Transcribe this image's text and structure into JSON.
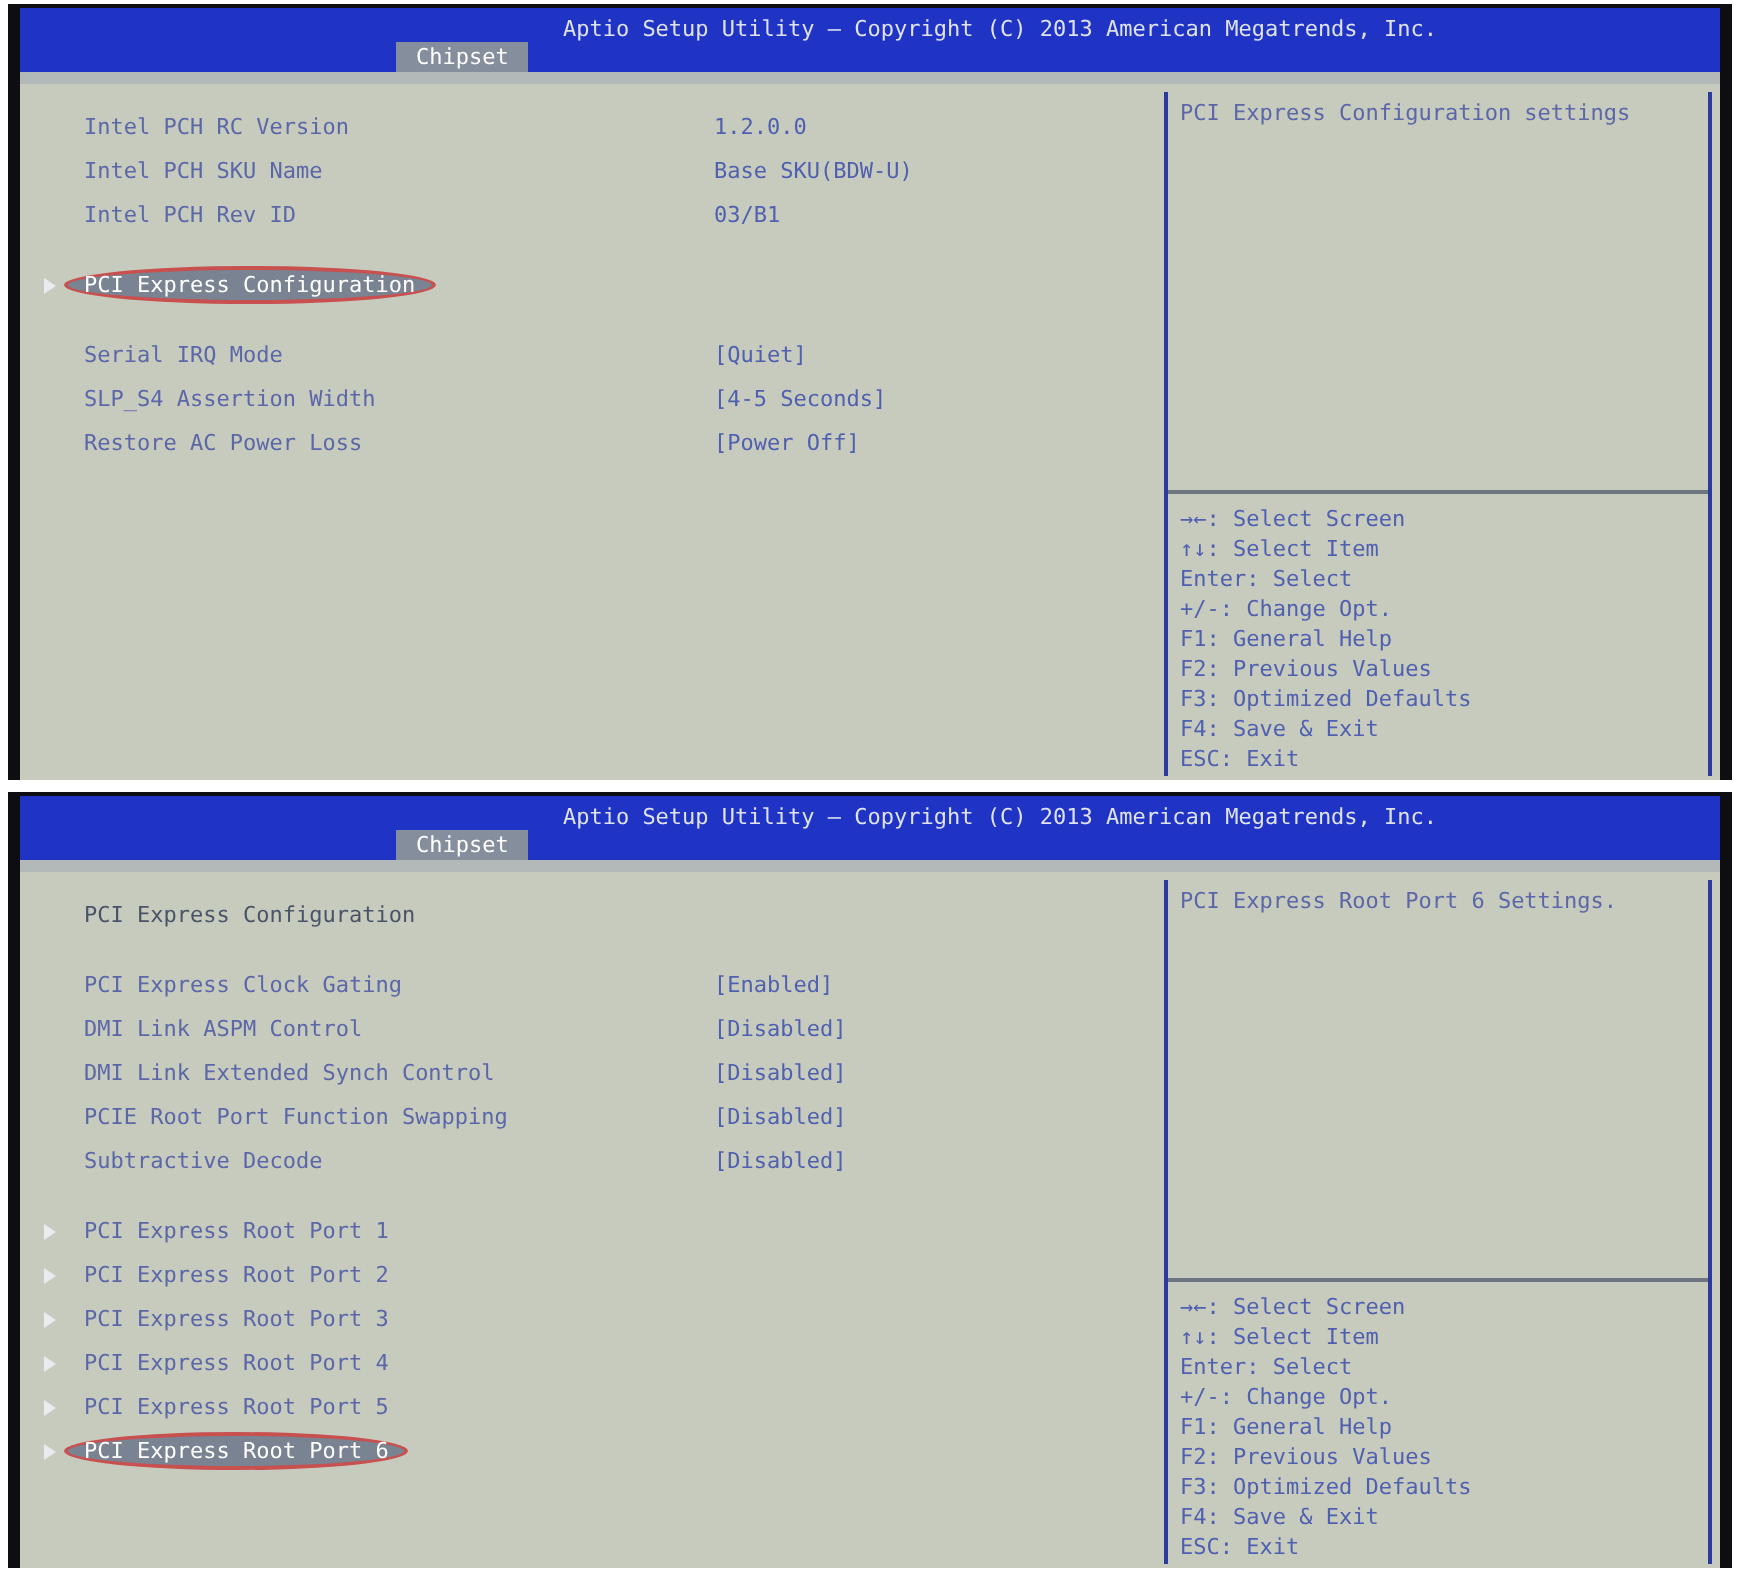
{
  "screens": [
    {
      "title": "Aptio Setup Utility – Copyright (C) 2013 American Megatrends, Inc.",
      "tabs": [
        {
          "label": "Chipset",
          "selected": true
        }
      ],
      "groups": [
        [
          {
            "kind": "info",
            "label": "Intel PCH RC Version",
            "value": "1.2.0.0",
            "selected": false,
            "circled": false
          },
          {
            "kind": "info",
            "label": "Intel PCH SKU Name",
            "value": "Base SKU(BDW-U)",
            "selected": false,
            "circled": false
          },
          {
            "kind": "info",
            "label": "Intel PCH Rev ID",
            "value": "03/B1",
            "selected": false,
            "circled": false
          }
        ],
        [
          {
            "kind": "submenu",
            "label": "PCI Express Configuration",
            "selected": true,
            "circled": true
          }
        ],
        [
          {
            "kind": "setting",
            "label": "Serial IRQ Mode",
            "value": "[Quiet]",
            "selected": false,
            "circled": false
          },
          {
            "kind": "setting",
            "label": "SLP_S4 Assertion Width",
            "value": "[4-5 Seconds]",
            "selected": false,
            "circled": false
          },
          {
            "kind": "setting",
            "label": "Restore AC Power Loss",
            "value": "[Power Off]",
            "selected": false,
            "circled": false
          }
        ]
      ],
      "help": "PCI Express Configuration settings",
      "keys": [
        "→←: Select Screen",
        "↑↓: Select Item",
        "Enter: Select",
        "+/-: Change Opt.",
        "F1: General Help",
        "F2: Previous Values",
        "F3: Optimized Defaults",
        "F4: Save & Exit",
        "ESC: Exit"
      ]
    },
    {
      "title": "Aptio Setup Utility – Copyright (C) 2013 American Megatrends, Inc.",
      "tabs": [
        {
          "label": "Chipset",
          "selected": true
        }
      ],
      "groups": [
        [
          {
            "kind": "heading",
            "label": "PCI Express Configuration",
            "selected": false,
            "circled": false
          }
        ],
        [
          {
            "kind": "setting",
            "label": "PCI Express Clock Gating",
            "value": "[Enabled]",
            "selected": false,
            "circled": false
          },
          {
            "kind": "setting",
            "label": "DMI Link ASPM Control",
            "value": "[Disabled]",
            "selected": false,
            "circled": false
          },
          {
            "kind": "setting",
            "label": "DMI Link Extended Synch Control",
            "value": "[Disabled]",
            "selected": false,
            "circled": false
          },
          {
            "kind": "setting",
            "label": "PCIE Root Port Function Swapping",
            "value": "[Disabled]",
            "selected": false,
            "circled": false
          },
          {
            "kind": "setting",
            "label": "Subtractive Decode",
            "value": "[Disabled]",
            "selected": false,
            "circled": false
          }
        ],
        [
          {
            "kind": "submenu",
            "label": "PCI Express Root Port 1",
            "selected": false,
            "circled": false
          },
          {
            "kind": "submenu",
            "label": "PCI Express Root Port 2",
            "selected": false,
            "circled": false
          },
          {
            "kind": "submenu",
            "label": "PCI Express Root Port 3",
            "selected": false,
            "circled": false
          },
          {
            "kind": "submenu",
            "label": "PCI Express Root Port 4",
            "selected": false,
            "circled": false
          },
          {
            "kind": "submenu",
            "label": "PCI Express Root Port 5",
            "selected": false,
            "circled": false
          },
          {
            "kind": "submenu",
            "label": "PCI Express Root Port 6",
            "selected": true,
            "circled": true
          }
        ]
      ],
      "help": "PCI Express Root Port 6 Settings.",
      "keys": [
        "→←: Select Screen",
        "↑↓: Select Item",
        "Enter: Select",
        "+/-: Change Opt.",
        "F1: General Help",
        "F2: Previous Values",
        "F3: Optimized Defaults",
        "F4: Save & Exit",
        "ESC: Exit"
      ]
    }
  ]
}
